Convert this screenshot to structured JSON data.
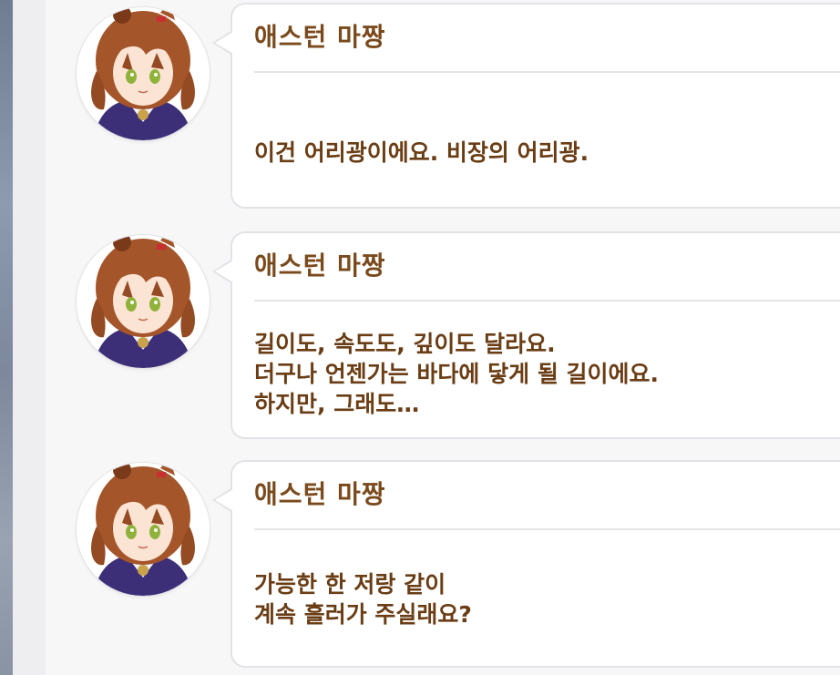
{
  "messages": [
    {
      "speaker": "애스턴 마짱",
      "lines": [
        "",
        "이건 어리광이에요. 비장의 어리광.",
        ""
      ]
    },
    {
      "speaker": "애스턴 마짱",
      "lines": [
        "길이도, 속도도, 깊이도 달라요.",
        "더구나 언젠가는 바다에 닿게 될 길이에요.",
        "하지만, 그래도…"
      ]
    },
    {
      "speaker": "애스턴 마짱",
      "lines": [
        "가능한 한 저랑 같이",
        "계속 흘러가 주실래요?",
        ""
      ]
    }
  ],
  "colors": {
    "speaker_text": "#7a4a1c",
    "dialogue_text": "#6a3d15",
    "hair": "#a5552a",
    "bubble_border": "#e3e3e7"
  }
}
